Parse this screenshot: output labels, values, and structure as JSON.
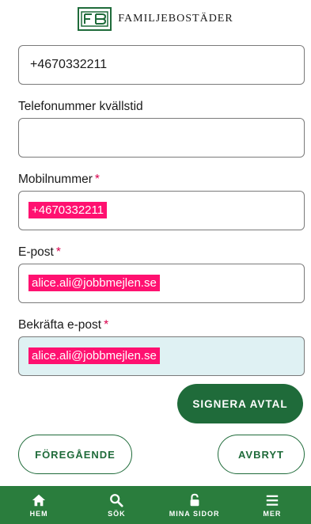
{
  "brand": {
    "name": "FAMILJEBOSTÄDER"
  },
  "form": {
    "phone_value": "+4670332211",
    "evening_label": "Telefonummer kvällstid",
    "evening_value": "",
    "mobile_label": "Mobilnummer",
    "mobile_value": "+4670332211",
    "email_label": "E-post",
    "email_value": "alice.ali@jobbmejlen.se",
    "confirm_label": "Bekräfta e-post",
    "confirm_value": "alice.ali@jobbmejlen.se",
    "required_mark": "*"
  },
  "actions": {
    "sign": "SIGNERA AVTAL",
    "previous": "FÖREGÅENDE",
    "cancel": "AVBRYT"
  },
  "nav": [
    {
      "label": "HEM",
      "icon": "home-icon"
    },
    {
      "label": "SÖK",
      "icon": "search-icon"
    },
    {
      "label": "MINA SIDOR",
      "icon": "lock-icon"
    },
    {
      "label": "MER",
      "icon": "menu-icon"
    }
  ],
  "colors": {
    "brand_green": "#1f6b3a",
    "nav_green": "#2a7d3d",
    "highlight": "#ff1170",
    "required": "#d8004c",
    "focus_bg": "#dff1f3"
  }
}
